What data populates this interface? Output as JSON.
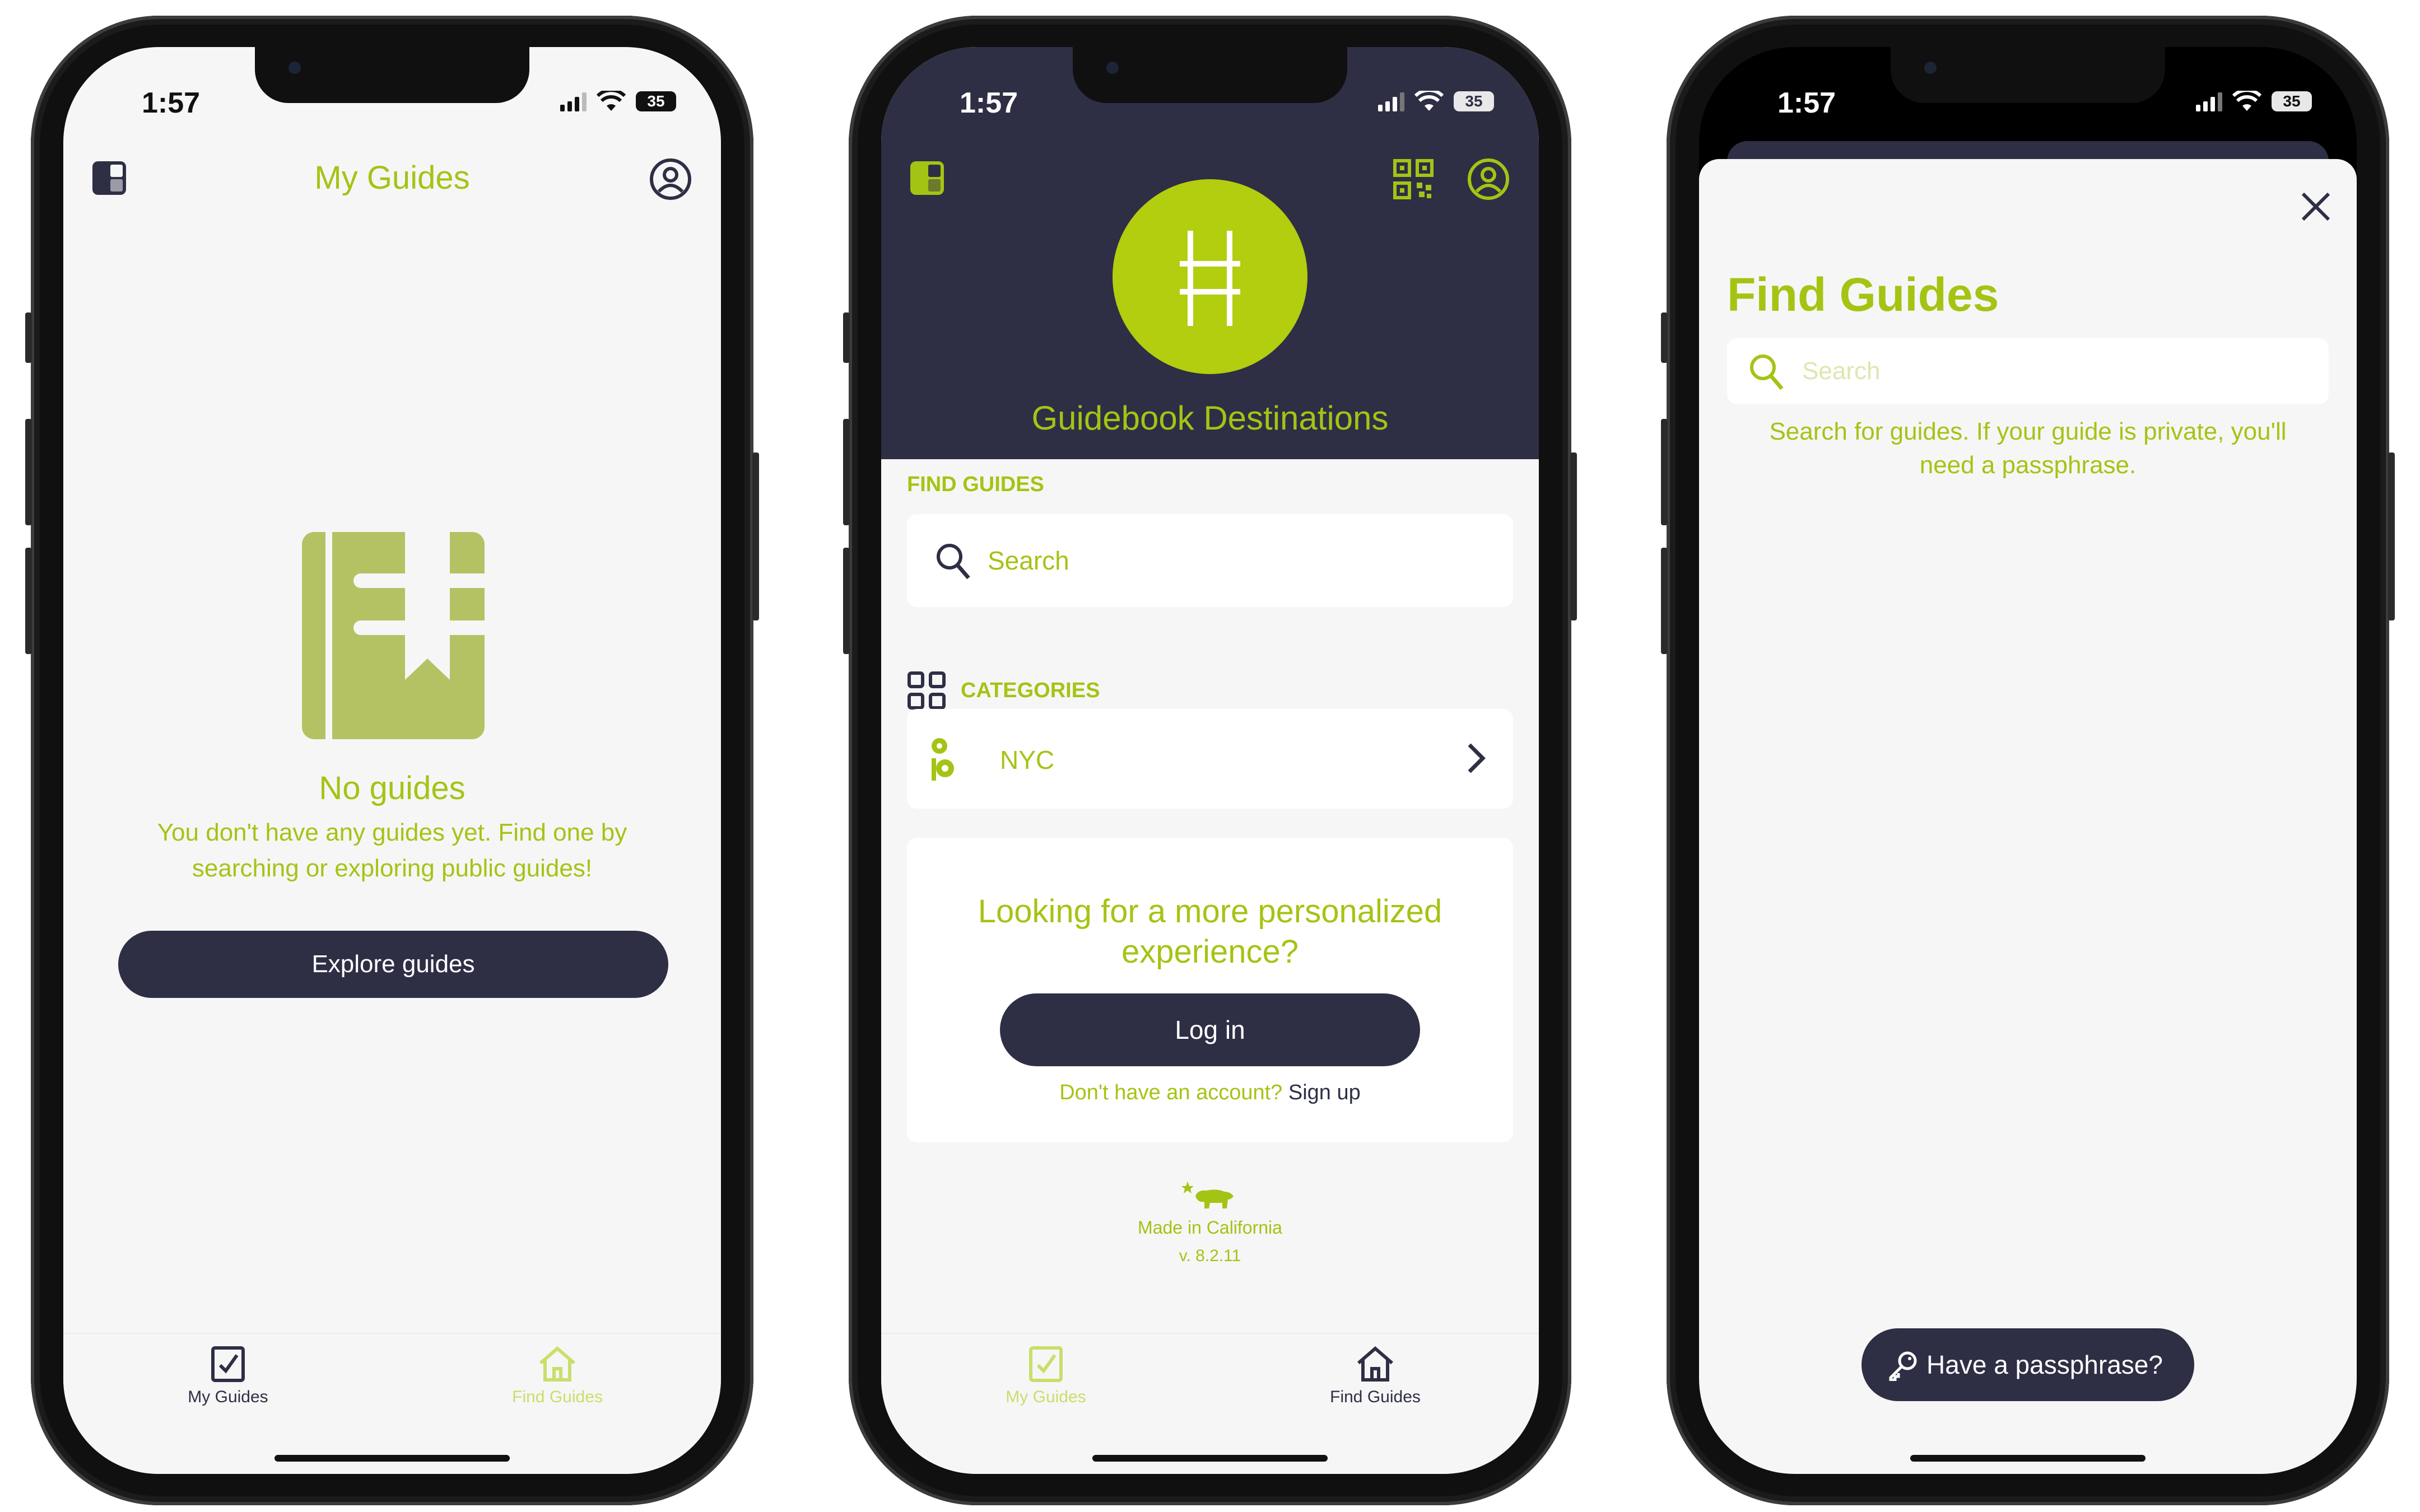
{
  "status": {
    "time": "1:57",
    "battery": "35"
  },
  "screen1": {
    "title": "My Guides",
    "empty_title": "No guides",
    "empty_desc_line1": "You don't have any guides yet. Find one by",
    "empty_desc_line2": "searching or exploring public guides!",
    "explore_button": "Explore guides"
  },
  "screen2": {
    "org_name": "Guidebook Destinations",
    "find_guides_heading": "FIND GUIDES",
    "search_placeholder": "Search",
    "categories_heading": "CATEGORIES",
    "categories": [
      {
        "label": "NYC"
      }
    ],
    "personalized_line1": "Looking for a more personalized",
    "personalized_line2": "experience?",
    "login_button": "Log in",
    "no_account": "Don't have an account?",
    "sign_up": "Sign up",
    "made_in": "Made in California",
    "version": "v. 8.2.11"
  },
  "screen3": {
    "title": "Find Guides",
    "search_placeholder": "Search",
    "hint_line1": "Search for guides. If your guide is private, you'll",
    "hint_line2": "need a passphrase.",
    "passphrase_button": "Have a passphrase?"
  },
  "tabs": {
    "my_guides": "My Guides",
    "find_guides": "Find Guides"
  },
  "colors": {
    "accent": "#a4c414",
    "navy": "#2e2f45",
    "olive": "#b4c264",
    "background": "#f6f6f6"
  },
  "icons": [
    "panel-icon",
    "account-icon",
    "book-bookmark-icon",
    "qr-code-icon",
    "guidebook-logo-icon",
    "search-icon",
    "grid-icon",
    "nyc-category-icon",
    "chevron-right-icon",
    "california-bear-icon",
    "close-icon",
    "key-icon",
    "checklist-icon",
    "home-icon"
  ]
}
